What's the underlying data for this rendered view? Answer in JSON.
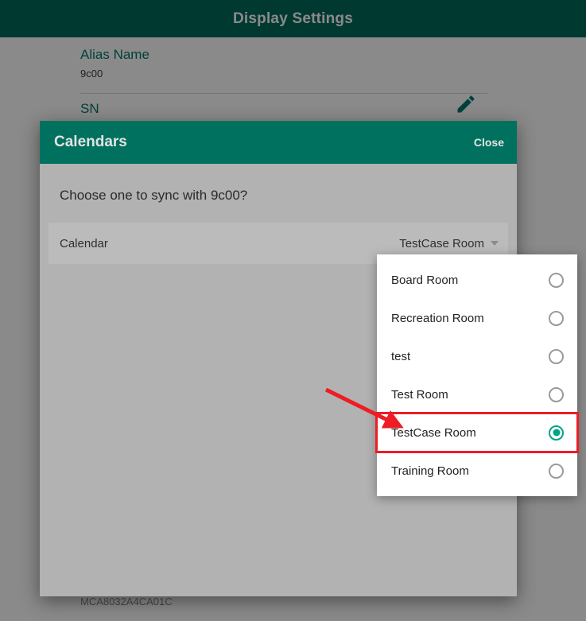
{
  "app": {
    "title": "Display Settings"
  },
  "page": {
    "fields": [
      {
        "label": "Alias Name",
        "value": "9c00"
      },
      {
        "label": "SN",
        "value": "MCA8032A4CA01C"
      }
    ],
    "edit_icon": "pencil-icon",
    "accent_color": "#00796b",
    "app_bar_color": "#00695a"
  },
  "dialog": {
    "title": "Calendars",
    "close_label": "Close",
    "prompt": "Choose one to sync with 9c00?",
    "row": {
      "label": "Calendar",
      "value": "TestCase Room",
      "caret_icon": "chevron-down-icon"
    },
    "header_color": "#00715f",
    "body_color": "#b2b2b2"
  },
  "dropdown": {
    "selected": "TestCase Room",
    "highlight_color": "#ee1c25",
    "radio_on_color": "#00a383",
    "options": [
      {
        "label": "Board Room",
        "selected": false
      },
      {
        "label": "Recreation Room",
        "selected": false
      },
      {
        "label": "test",
        "selected": false
      },
      {
        "label": "Test Room",
        "selected": false
      },
      {
        "label": "TestCase Room",
        "selected": true
      },
      {
        "label": "Training Room",
        "selected": false
      }
    ]
  },
  "annotation": {
    "arrow_color": "#ee1c25",
    "points_to": "TestCase Room"
  }
}
